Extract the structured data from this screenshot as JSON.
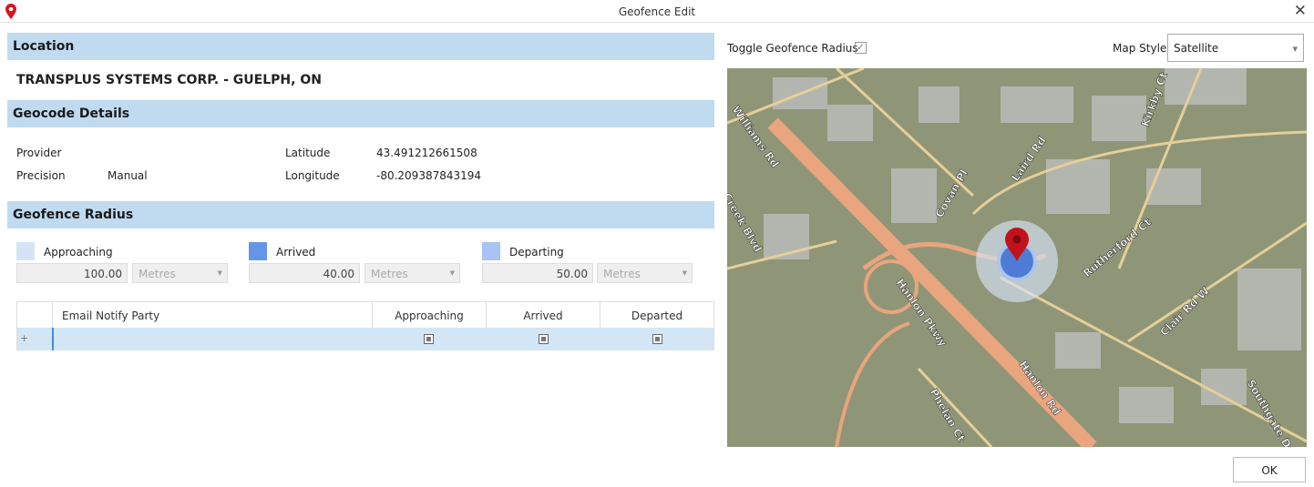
{
  "window": {
    "title": "Geofence Edit",
    "icon": "map-pin-icon",
    "close": "✕"
  },
  "location": {
    "header": "Location",
    "name": "TRANSPLUS SYSTEMS CORP. - GUELPH, ON"
  },
  "geocode": {
    "header": "Geocode Details",
    "provider_label": "Provider",
    "provider_value": "",
    "precision_label": "Precision",
    "precision_value": "Manual",
    "latitude_label": "Latitude",
    "latitude_value": "43.491212661508",
    "longitude_label": "Longitude",
    "longitude_value": "-80.209387843194"
  },
  "radius": {
    "header": "Geofence Radius",
    "items": [
      {
        "label": "Approaching",
        "value": "100.00",
        "unit": "Metres",
        "color": "#d6e3f7"
      },
      {
        "label": "Arrived",
        "value": "40.00",
        "unit": "Metres",
        "color": "#6495e8"
      },
      {
        "label": "Departing",
        "value": "50.00",
        "unit": "Metres",
        "color": "#a9c3f2"
      }
    ]
  },
  "grid": {
    "columns": [
      "Email Notify Party",
      "Approaching",
      "Arrived",
      "Departed"
    ],
    "new_row_symbol": "+"
  },
  "map": {
    "toggle_label": "Toggle Geofence Radius",
    "toggle_checked": true,
    "style_label": "Map Style",
    "style_value": "Satellite",
    "street_labels": [
      "Hanlon Pkwy",
      "Laird Rd",
      "Covan Pl",
      "Rutherford Ct",
      "Kirkby Ct",
      "Williams Rd",
      "Creek Blvd",
      "Hanlon Rd",
      "Phelan Ct",
      "Clair Rd W",
      "Southgate Dr"
    ]
  },
  "footer": {
    "ok": "OK"
  }
}
